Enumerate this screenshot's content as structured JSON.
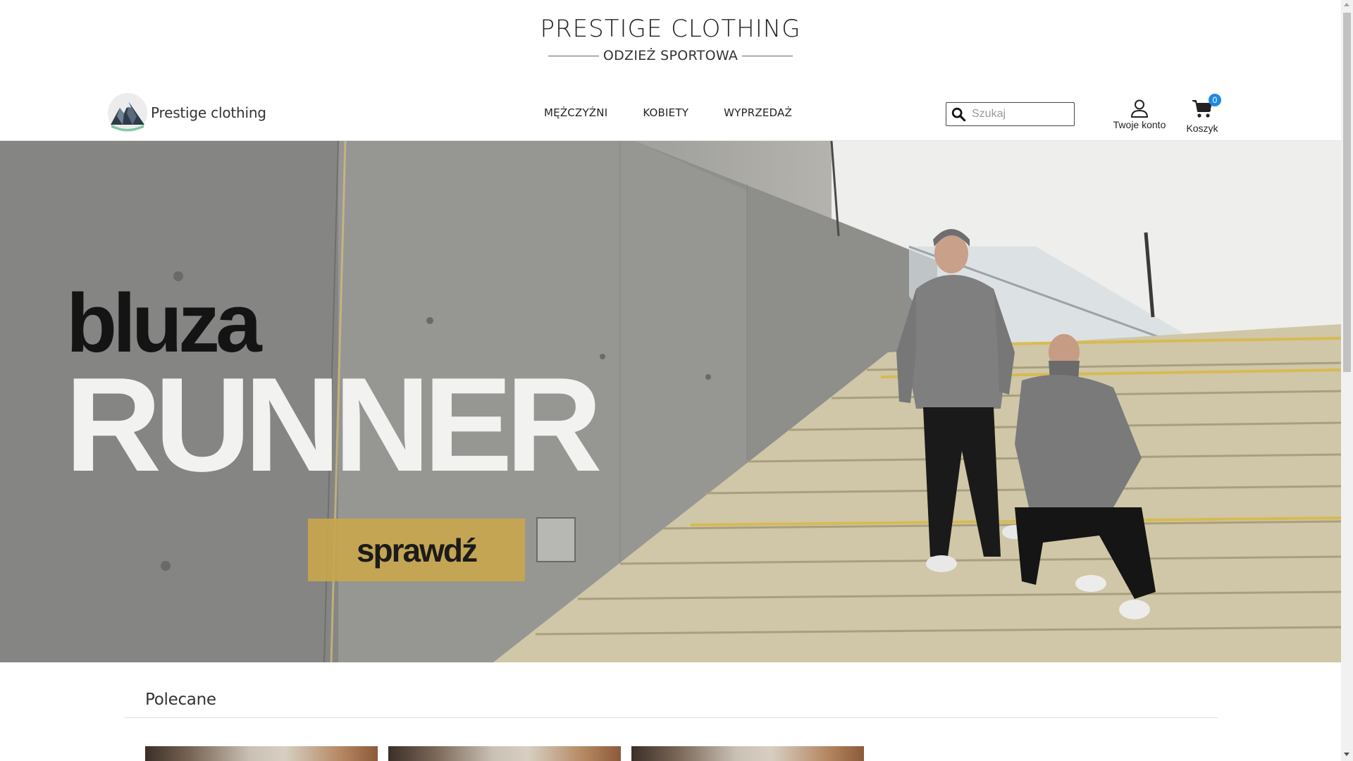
{
  "brand": {
    "title": "PRESTIGE CLOTHING",
    "subtitle": "ODZIEŻ SPORTOWA"
  },
  "logo": {
    "text": "Prestige clothing"
  },
  "nav": {
    "items": [
      {
        "label": "MĘŻCZYŹNI"
      },
      {
        "label": "KOBIETY"
      },
      {
        "label": "WYPRZEDAŻ"
      }
    ]
  },
  "search": {
    "placeholder": "Szukaj",
    "value": ""
  },
  "account": {
    "label": "Twoje konto",
    "icon": "user-icon"
  },
  "cart": {
    "label": "Koszyk",
    "count": "0",
    "icon": "shopping-cart-icon"
  },
  "hero": {
    "word_small": "bluza",
    "word_big": "RUNNER",
    "cta": "sprawdź"
  },
  "recommended": {
    "title": "Polecane",
    "product_count_visible": 3
  },
  "colors": {
    "cart_badge": "#1e88e5",
    "cta_background": "#c9a64c",
    "text_dark": "#222222"
  }
}
